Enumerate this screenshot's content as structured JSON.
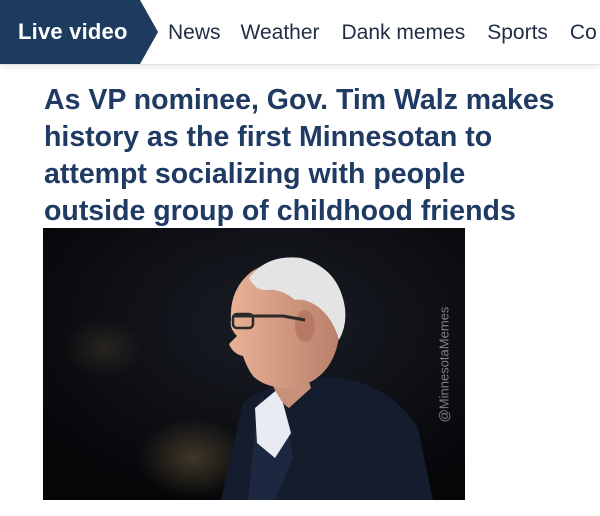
{
  "nav": {
    "live_label": "Live video",
    "items": [
      "News",
      "Weather",
      "Dank memes",
      "Sports",
      "Co"
    ]
  },
  "headline": "As VP nominee, Gov. Tim Walz makes history as the first Minnesotan to attempt socializing with people outside group of childhood friends",
  "photo": {
    "watermark": "@MinnesotaMemes"
  },
  "colors": {
    "live_bg": "#1d3a5f",
    "nav_text": "#1f2d44",
    "headline": "#1f3a63",
    "photo_bg": "#07080c"
  }
}
